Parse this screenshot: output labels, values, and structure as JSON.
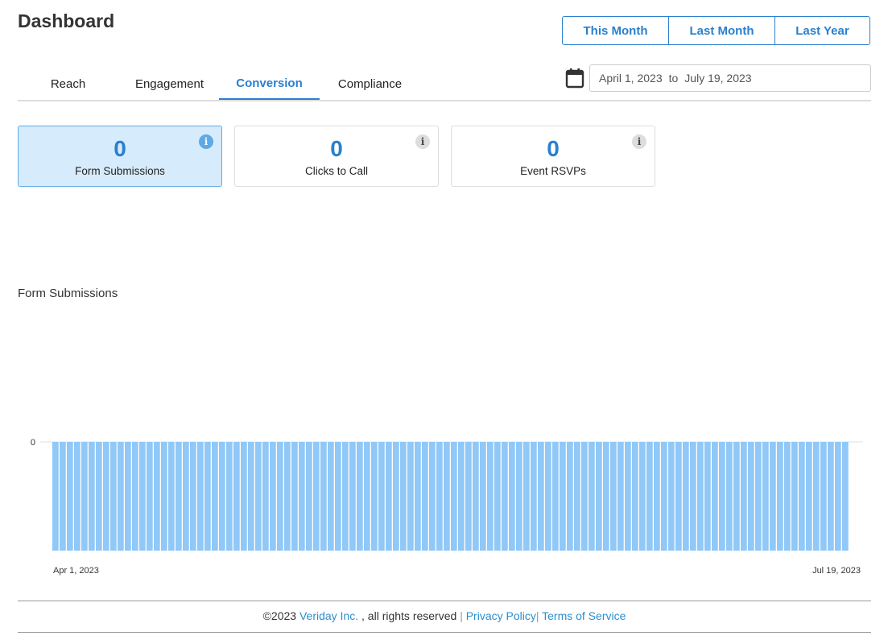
{
  "header": {
    "title": "Dashboard",
    "range_buttons": [
      "This Month",
      "Last Month",
      "Last Year"
    ]
  },
  "tabs": [
    {
      "label": "Reach",
      "active": false
    },
    {
      "label": "Engagement",
      "active": false
    },
    {
      "label": "Conversion",
      "active": true
    },
    {
      "label": "Compliance",
      "active": false
    }
  ],
  "date_range": {
    "icon": "calendar-icon",
    "from": "April 1, 2023",
    "separator": "to",
    "to": "July 19, 2023"
  },
  "stats": [
    {
      "value": "0",
      "label": "Form Submissions",
      "active": true,
      "icon": "i"
    },
    {
      "value": "0",
      "label": "Clicks to Call",
      "active": false,
      "icon": "i"
    },
    {
      "value": "0",
      "label": "Event RSVPs",
      "active": false,
      "icon": "i"
    }
  ],
  "chart_title": "Form Submissions",
  "chart_data": {
    "type": "bar",
    "title": "Form Submissions",
    "x_start": "Apr 1, 2023",
    "x_end": "Jul 19, 2023",
    "x_tick_labels": [
      "Apr 1, 2023",
      "Jul 19, 2023"
    ],
    "y_tick_labels": [
      "0"
    ],
    "bar_count": 110,
    "values_all": 0,
    "bar_color": "#90c8f7",
    "grid": true
  },
  "footer": {
    "copyright": "©2023",
    "company": "Veriday Inc.",
    "rights": ", all rights reserved",
    "pipe": "|",
    "privacy": "Privacy Policy",
    "terms": "Terms of Service"
  },
  "colors": {
    "accent": "#2a7fcf",
    "active_card_bg": "#d6ebfb",
    "link": "#2a8fcf"
  }
}
